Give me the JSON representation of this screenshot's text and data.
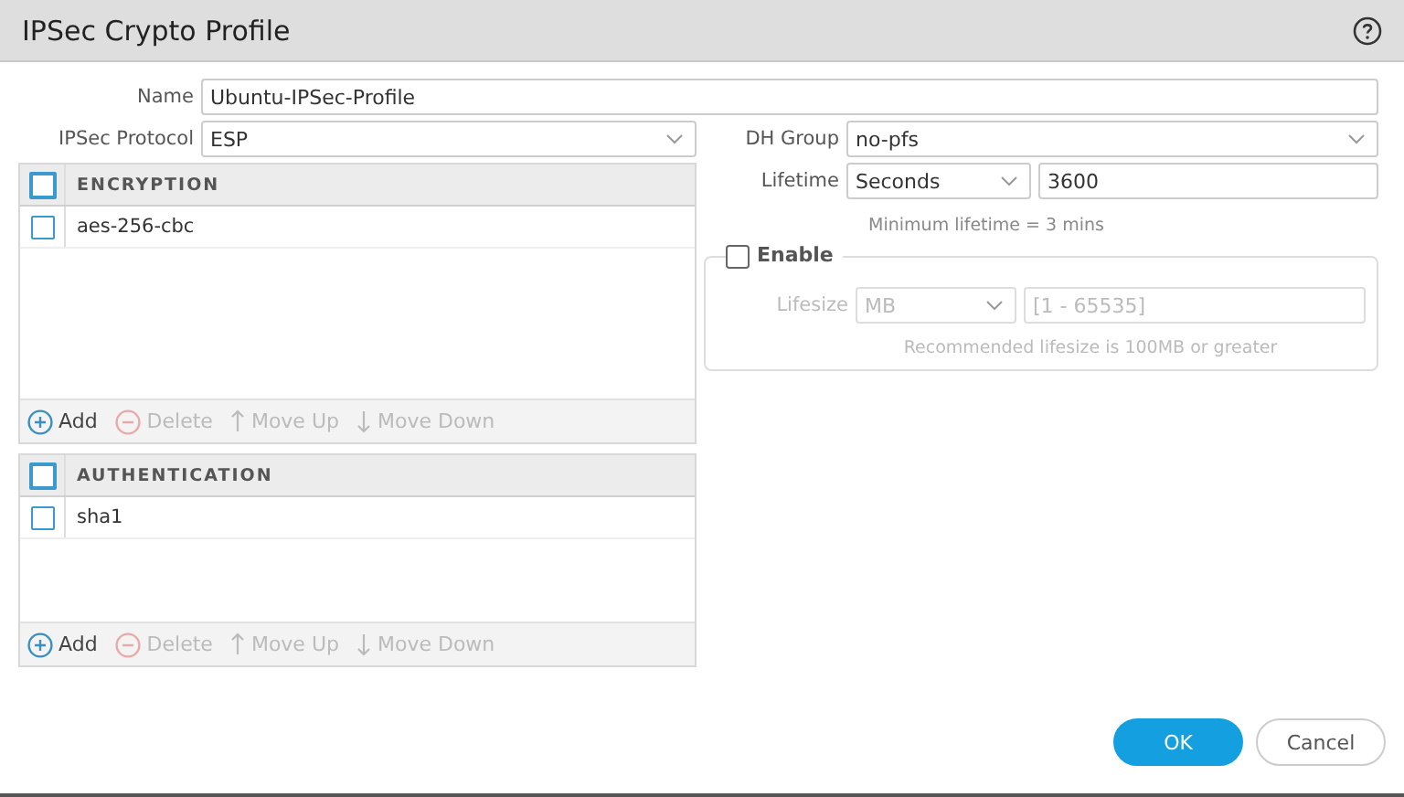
{
  "window": {
    "title": "IPSec Crypto Profile"
  },
  "name": {
    "label": "Name",
    "value": "Ubuntu-IPSec-Profile"
  },
  "ipsec_protocol": {
    "label": "IPSec Protocol",
    "value": "ESP"
  },
  "tables": [
    {
      "header": "ENCRYPTION",
      "header_checked": false,
      "rows": [
        {
          "value": "aes-256-cbc",
          "checked": false
        }
      ],
      "actions": [
        {
          "kind": "add",
          "label": "Add",
          "disabled": false
        },
        {
          "kind": "delete",
          "label": "Delete",
          "disabled": true
        },
        {
          "kind": "up",
          "label": "Move Up",
          "disabled": true
        },
        {
          "kind": "down",
          "label": "Move Down",
          "disabled": true
        }
      ]
    },
    {
      "header": "AUTHENTICATION",
      "header_checked": false,
      "rows": [
        {
          "value": "sha1",
          "checked": false
        }
      ],
      "actions": [
        {
          "kind": "add",
          "label": "Add",
          "disabled": false
        },
        {
          "kind": "delete",
          "label": "Delete",
          "disabled": true
        },
        {
          "kind": "up",
          "label": "Move Up",
          "disabled": true
        },
        {
          "kind": "down",
          "label": "Move Down",
          "disabled": true
        }
      ]
    }
  ],
  "dh_group": {
    "label": "DH Group",
    "value": "no-pfs"
  },
  "lifetime": {
    "label": "Lifetime",
    "unit": "Seconds",
    "value": "3600",
    "hint": "Minimum lifetime = 3 mins"
  },
  "lifesize": {
    "enable_label": "Enable",
    "enabled": false,
    "label": "Lifesize",
    "unit": "MB",
    "placeholder": "[1 - 65535]",
    "hint": "Recommended lifesize is 100MB or greater"
  },
  "buttons": [
    {
      "kind": "primary",
      "label": "OK"
    },
    {
      "kind": "secondary",
      "label": "Cancel"
    }
  ]
}
